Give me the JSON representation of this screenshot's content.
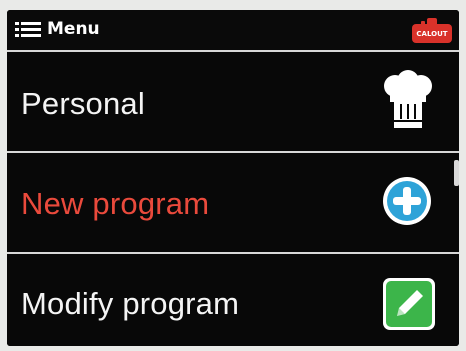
{
  "header": {
    "title": "Menu",
    "badge_label": "CALOUT",
    "badge_color": "#d9322a",
    "menu_icon": "list-icon"
  },
  "items": [
    {
      "label": "Personal",
      "icon": "chef-hat-icon",
      "active": false
    },
    {
      "label": "New program",
      "icon": "add-circle-icon",
      "active": true,
      "icon_color": "#2ea3d8"
    },
    {
      "label": "Modify program",
      "icon": "edit-pencil-icon",
      "active": false,
      "icon_color": "#3cb54a"
    }
  ],
  "colors": {
    "active_text": "#ea4a3c",
    "text": "#f4f4f4",
    "background": "#070707"
  }
}
